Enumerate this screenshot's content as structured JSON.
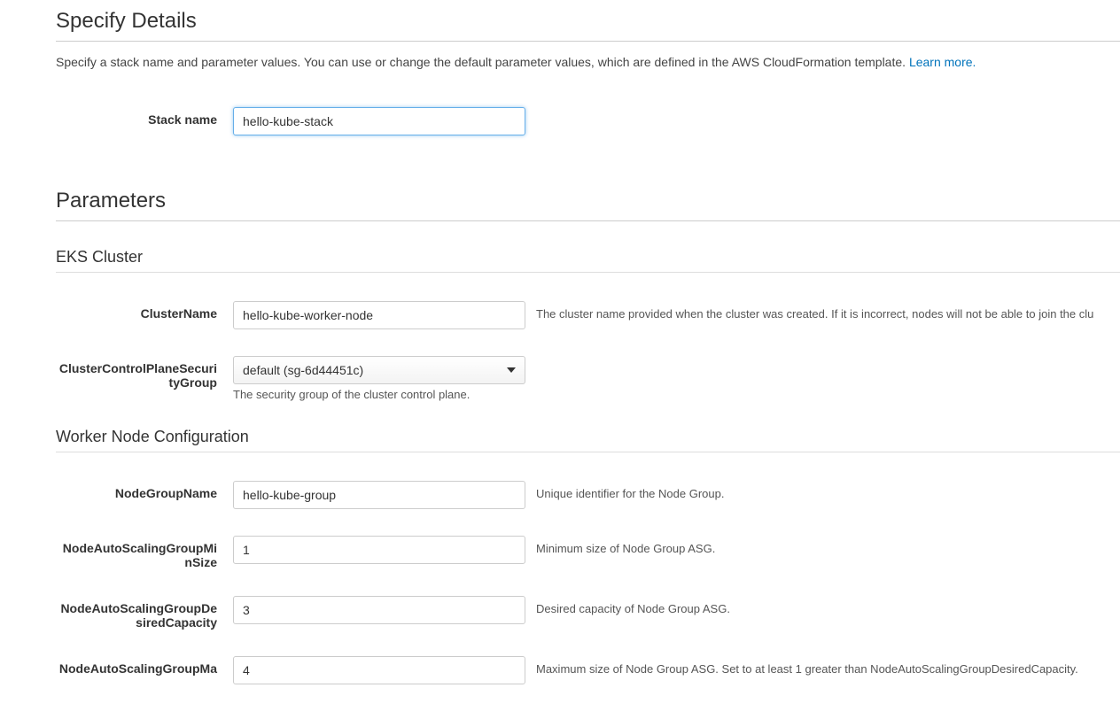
{
  "specifyDetails": {
    "title": "Specify Details",
    "description": "Specify a stack name and parameter values. You can use or change the default parameter values, which are defined in the AWS CloudFormation template. ",
    "learnMore": "Learn more.",
    "stackNameLabel": "Stack name",
    "stackNameValue": "hello-kube-stack"
  },
  "parameters": {
    "title": "Parameters",
    "eksCluster": {
      "title": "EKS Cluster",
      "clusterName": {
        "label": "ClusterName",
        "value": "hello-kube-worker-node",
        "hint": "The cluster name provided when the cluster was created. If it is incorrect, nodes will not be able to join the clu"
      },
      "securityGroup": {
        "label": "ClusterControlPlaneSecurityGroup",
        "value": "default (sg-6d44451c)",
        "subhint": "The security group of the cluster control plane."
      }
    },
    "workerNode": {
      "title": "Worker Node Configuration",
      "nodeGroupName": {
        "label": "NodeGroupName",
        "value": "hello-kube-group",
        "hint": "Unique identifier for the Node Group."
      },
      "minSize": {
        "label": "NodeAutoScalingGroupMinSize",
        "value": "1",
        "hint": "Minimum size of Node Group ASG."
      },
      "desiredCapacity": {
        "label": "NodeAutoScalingGroupDesiredCapacity",
        "value": "3",
        "hint": "Desired capacity of Node Group ASG."
      },
      "maxSize": {
        "label": "NodeAutoScalingGroupMa",
        "value": "4",
        "hint": "Maximum size of Node Group ASG. Set to at least 1 greater than NodeAutoScalingGroupDesiredCapacity."
      }
    }
  }
}
